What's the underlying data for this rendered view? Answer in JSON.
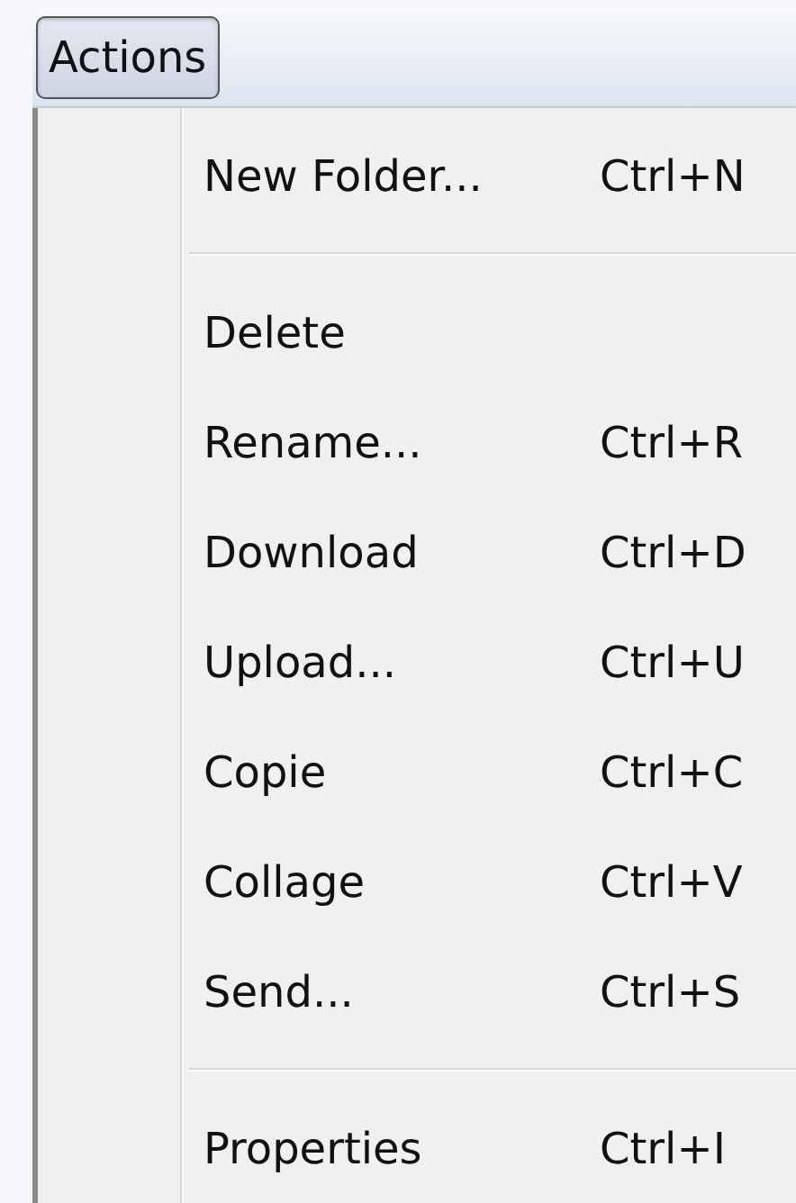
{
  "menu_bar": {
    "menu": {
      "label": "Actions",
      "selected": true
    }
  },
  "menu_items": [
    {
      "kind": "item",
      "label": "New Folder...",
      "shortcut": "Ctrl+N"
    },
    {
      "kind": "separator"
    },
    {
      "kind": "item",
      "label": "Delete"
    },
    {
      "kind": "item",
      "label": "Rename...",
      "shortcut": "Ctrl+R"
    },
    {
      "kind": "item",
      "label": "Download",
      "shortcut": "Ctrl+D"
    },
    {
      "kind": "item",
      "label": "Upload...",
      "shortcut": "Ctrl+U"
    },
    {
      "kind": "item",
      "label": "Copie",
      "shortcut": "Ctrl+C"
    },
    {
      "kind": "item",
      "label": "Collage",
      "shortcut": "Ctrl+V"
    },
    {
      "kind": "item",
      "label": "Send...",
      "shortcut": "Ctrl+S"
    },
    {
      "kind": "separator"
    },
    {
      "kind": "item",
      "label": "Properties",
      "shortcut": "Ctrl+I"
    }
  ]
}
